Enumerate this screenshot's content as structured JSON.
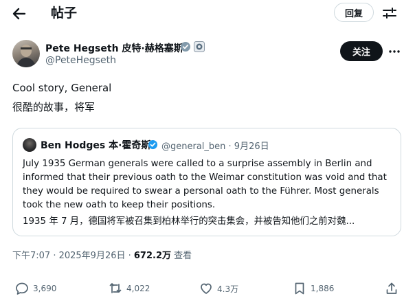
{
  "header": {
    "title": "帖子",
    "reply_button": "回复"
  },
  "post": {
    "author_name": "Pete Hegseth 皮特·赫格塞斯",
    "author_handle": "@PeteHegseth",
    "follow_button": "关注",
    "text_en": "Cool story, General",
    "text_zh": "很酷的故事，将军",
    "meta": {
      "time": "下午7:07 · 2025年9月26日 · ",
      "views": "672.2万",
      "views_label": " 查看"
    }
  },
  "quote": {
    "author_name": "Ben Hodges 本·霍奇斯",
    "meta": "@general_ben · 9月26日",
    "text_en": "July 1935 German generals were called to a surprise assembly in Berlin and informed that their previous oath to the Weimar constitution was void and that they would be required to swear a personal oath to the Führer. Most generals took the new oath to keep their positions.",
    "text_zh": "1935 年 7 月，德国将军被召集到柏林举行的突击集会，并被告知他们之前对魏..."
  },
  "actions": {
    "replies": "3,690",
    "reposts": "4,022",
    "likes": "4.3万",
    "bookmarks": "1,886"
  },
  "colors": {
    "text": "#0f1419",
    "muted": "#536471",
    "border": "#cfd9de",
    "verified": "#1d9bf0"
  }
}
